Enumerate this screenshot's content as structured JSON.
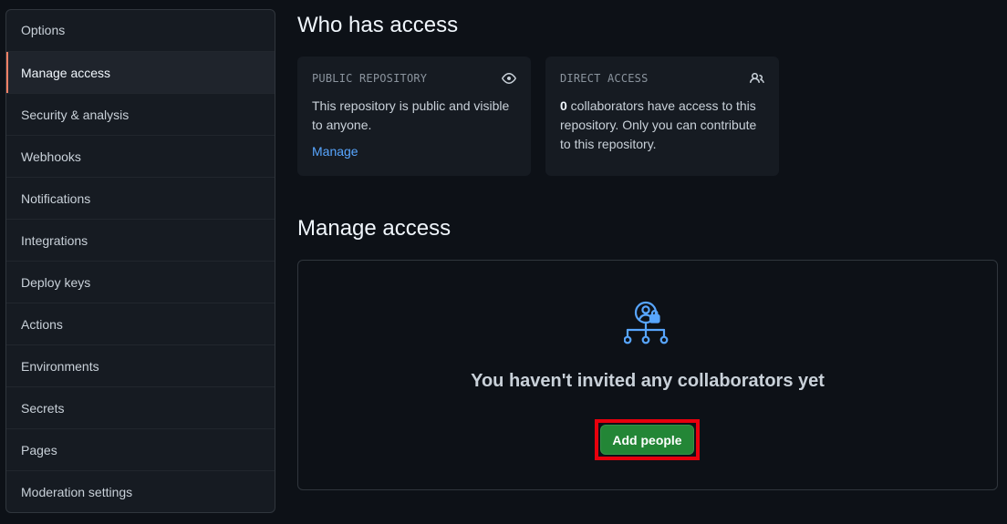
{
  "sidebar": {
    "items": [
      {
        "label": "Options"
      },
      {
        "label": "Manage access",
        "selected": true
      },
      {
        "label": "Security & analysis"
      },
      {
        "label": "Webhooks"
      },
      {
        "label": "Notifications"
      },
      {
        "label": "Integrations"
      },
      {
        "label": "Deploy keys"
      },
      {
        "label": "Actions"
      },
      {
        "label": "Environments"
      },
      {
        "label": "Secrets"
      },
      {
        "label": "Pages"
      },
      {
        "label": "Moderation settings"
      }
    ]
  },
  "who_has_access": {
    "title": "Who has access",
    "public_card": {
      "label": "PUBLIC REPOSITORY",
      "icon": "eye-icon",
      "text": "This repository is public and visible to anyone.",
      "link": "Manage"
    },
    "direct_card": {
      "label": "DIRECT ACCESS",
      "icon": "people-icon",
      "count": "0",
      "text": " collaborators have access to this repository. Only you can contribute to this repository."
    }
  },
  "manage_access": {
    "title": "Manage access",
    "icon": "person-lock-org-icon",
    "empty_message": "You haven't invited any collaborators yet",
    "add_button": "Add people"
  },
  "colors": {
    "background": "#0d1117",
    "accent_selected": "#f78166",
    "link": "#58a6ff",
    "button": "#238636",
    "highlight_outline": "#e8000d"
  }
}
